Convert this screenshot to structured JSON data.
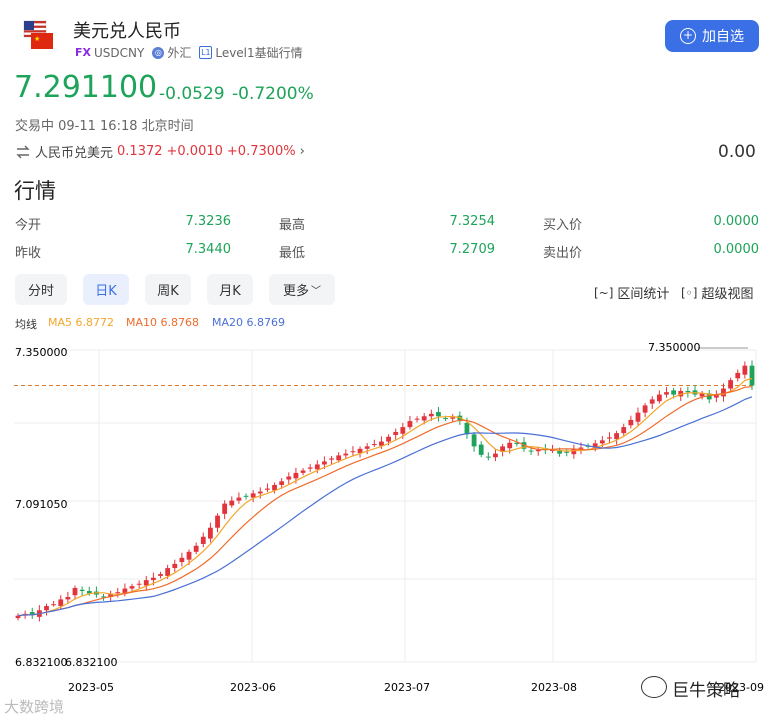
{
  "header": {
    "title": "美元兑人民币",
    "fx_tag": "FX",
    "symbol": "USDCNY",
    "market": "外汇",
    "level": "Level1基础行情",
    "add_button": "加自选"
  },
  "quote": {
    "price": "7.291100",
    "change": "-0.0529",
    "change_pct": "-0.7200%",
    "status": "交易中 09-11 16:18 北京时间",
    "reverse_label": "人民币兑美元",
    "reverse_price": "0.1372",
    "reverse_change": "+0.0010",
    "reverse_pct": "+0.7300%",
    "right_value": "0.00"
  },
  "market": {
    "title": "行情",
    "rows": [
      {
        "l1": "今开",
        "v1": "7.3236",
        "l2": "最高",
        "v2": "7.3254",
        "l3": "买入价",
        "v3": "0.0000"
      },
      {
        "l1": "昨收",
        "v1": "7.3440",
        "l2": "最低",
        "v2": "7.2709",
        "l3": "卖出价",
        "v3": "0.0000"
      }
    ]
  },
  "tabs": [
    "分时",
    "日K",
    "周K",
    "月K",
    "更多"
  ],
  "tools": {
    "range": "区间统计",
    "super": "超级视图"
  },
  "ma": {
    "label": "均线",
    "ma5": "MA5 6.8772",
    "ma10": "MA10 6.8768",
    "ma20": "MA20 6.8769"
  },
  "colors": {
    "up": "#e2343c",
    "down": "#1ea35a",
    "ma5": "#f4a62a",
    "ma10": "#ef6c2b",
    "ma20": "#4a6fd6",
    "accent": "#3a6fe6"
  },
  "chart_data": {
    "type": "candlestick",
    "y_labels": [
      "7.350000",
      "7.091050",
      "6.832100"
    ],
    "ylim": [
      6.8321,
      7.35
    ],
    "ref_line": 7.2911,
    "high_label": "7.350000",
    "low_label": "6.832100",
    "x_ticks": [
      "2023-05",
      "2023-06",
      "2023-07",
      "2023-08",
      "2023-09"
    ],
    "closes": [
      6.909,
      6.912,
      6.91,
      6.918,
      6.925,
      6.928,
      6.936,
      6.94,
      6.955,
      6.95,
      6.946,
      6.944,
      6.94,
      6.945,
      6.948,
      6.954,
      6.958,
      6.962,
      6.968,
      6.972,
      6.978,
      6.988,
      6.995,
      7.005,
      7.015,
      7.025,
      7.04,
      7.055,
      7.075,
      7.095,
      7.1,
      7.105,
      7.108,
      7.112,
      7.115,
      7.12,
      7.126,
      7.132,
      7.14,
      7.146,
      7.15,
      7.155,
      7.16,
      7.165,
      7.17,
      7.175,
      7.178,
      7.182,
      7.186,
      7.19,
      7.194,
      7.198,
      7.206,
      7.214,
      7.222,
      7.232,
      7.236,
      7.24,
      7.244,
      7.24,
      7.236,
      7.238,
      7.232,
      7.21,
      7.19,
      7.176,
      7.172,
      7.178,
      7.19,
      7.196,
      7.194,
      7.186,
      7.182,
      7.184,
      7.186,
      7.184,
      7.178,
      7.18,
      7.186,
      7.188,
      7.19,
      7.195,
      7.2,
      7.205,
      7.212,
      7.222,
      7.234,
      7.246,
      7.258,
      7.268,
      7.276,
      7.28,
      7.276,
      7.282,
      7.28,
      7.276,
      7.278,
      7.268,
      7.276,
      7.286,
      7.3,
      7.312,
      7.324,
      7.2911
    ]
  },
  "watermark": {
    "left": "大数跨境",
    "right": "巨牛策略"
  }
}
